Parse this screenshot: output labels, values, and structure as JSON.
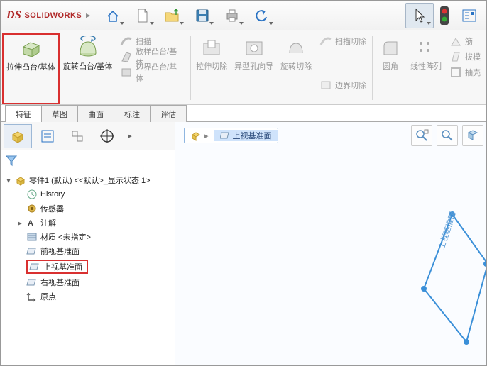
{
  "app": {
    "brand": "SOLIDWORKS"
  },
  "ribbon": {
    "extrude": "拉伸凸台/基体",
    "revolve": "旋转凸台/基体",
    "sweep": "扫描",
    "loft": "放样凸台/基体",
    "boundary": "边界凸台/基体",
    "cut_extrude": "拉伸切除",
    "hole": "异型孔向导",
    "cut_revolve": "旋转切除",
    "cut_sweep": "扫描切除",
    "cut_boundary": "边界切除",
    "fillet": "圆角",
    "pattern": "线性阵列",
    "rib": "筋",
    "draft": "拔模",
    "shell": "抽壳"
  },
  "tabs": [
    "特征",
    "草图",
    "曲面",
    "标注",
    "评估"
  ],
  "tree": {
    "root": "零件1 (默认) <<默认>_显示状态 1>",
    "history": "History",
    "sensors": "传感器",
    "annotations": "注解",
    "material": "材质 <未指定>",
    "front": "前视基准面",
    "top": "上视基准面",
    "right": "右视基准面",
    "origin": "原点"
  },
  "breadcrumb": {
    "plane_label": "上视基准面"
  },
  "viewport": {
    "plane_text": "上视基准面"
  }
}
